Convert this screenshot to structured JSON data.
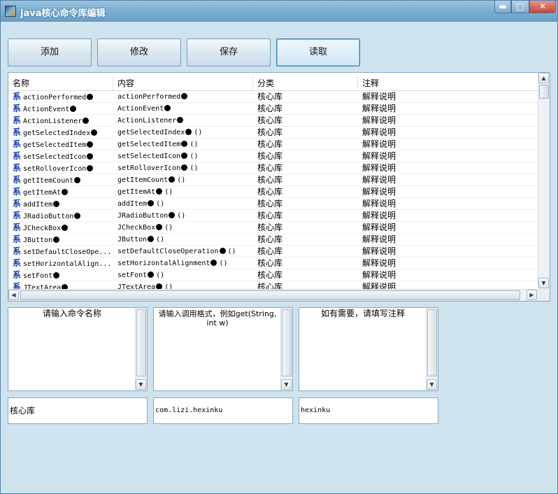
{
  "window": {
    "title": "java核心命令库编辑",
    "minimize_glyph": "▬",
    "maximize_glyph": "□",
    "close_glyph": "✕",
    "icon": "app-icon"
  },
  "toolbar": {
    "add_label": "添加",
    "edit_label": "修改",
    "save_label": "保存",
    "read_label": "读取"
  },
  "table": {
    "columns": [
      "名称",
      "内容",
      "分类",
      "注释"
    ],
    "row_icon_glyph": "系",
    "rows": [
      {
        "name": "actionPerformed",
        "content": "actionPerformed",
        "content_suffix": "",
        "category": "核心库",
        "note": "解释说明"
      },
      {
        "name": "ActionEvent",
        "content": "ActionEvent",
        "content_suffix": "",
        "category": "核心库",
        "note": "解释说明"
      },
      {
        "name": "ActionListener",
        "content": "ActionListener",
        "content_suffix": "",
        "category": "核心库",
        "note": "解释说明"
      },
      {
        "name": "getSelectedIndex",
        "content": "getSelectedIndex",
        "content_suffix": "()",
        "category": "核心库",
        "note": "解释说明"
      },
      {
        "name": "getSelectedItem",
        "content": "getSelectedItem",
        "content_suffix": "()",
        "category": "核心库",
        "note": "解释说明"
      },
      {
        "name": "setSelectedIcon",
        "content": "setSelectedIcon",
        "content_suffix": "()",
        "category": "核心库",
        "note": "解释说明"
      },
      {
        "name": "setRolloverIcon",
        "content": "setRolloverIcon",
        "content_suffix": "()",
        "category": "核心库",
        "note": "解释说明"
      },
      {
        "name": "getItemCount",
        "content": "getItemCount",
        "content_suffix": "()",
        "category": "核心库",
        "note": "解释说明"
      },
      {
        "name": "getItemAt",
        "content": "getItemAt",
        "content_suffix": "()",
        "category": "核心库",
        "note": "解释说明"
      },
      {
        "name": "addItem",
        "content": "addItem",
        "content_suffix": "()",
        "category": "核心库",
        "note": "解释说明"
      },
      {
        "name": "JRadioButton",
        "content": "JRadioButton",
        "content_suffix": "()",
        "category": "核心库",
        "note": "解释说明"
      },
      {
        "name": "JCheckBox",
        "content": "JCheckBox",
        "content_suffix": "()",
        "category": "核心库",
        "note": "解释说明"
      },
      {
        "name": "JButton",
        "content": "JButton",
        "content_suffix": "()",
        "category": "核心库",
        "note": "解释说明"
      },
      {
        "name": "setDefaultCloseOpe...",
        "content": "setDefaultCloseOperation",
        "content_suffix": "()",
        "category": "核心库",
        "note": "解释说明",
        "name_truncated": true
      },
      {
        "name": "setHorizontalAlign...",
        "content": "setHorizontalAlignment",
        "content_suffix": "()",
        "category": "核心库",
        "note": "解释说明",
        "name_truncated": true
      },
      {
        "name": "setFont",
        "content": "setFont",
        "content_suffix": "()",
        "category": "核心库",
        "note": "解释说明"
      },
      {
        "name": "JTextArea",
        "content": "JTextArea",
        "content_suffix": "()",
        "category": "核心库",
        "note": "解释说明"
      }
    ]
  },
  "inputs": {
    "name_area_text": "请输入命令名称",
    "content_area_text": "请输入调用格式，例如get(String, int w)",
    "note_area_text": "如有需要，请填写注释",
    "category_field": "核心库",
    "package_field": "com.lizi.hexinku",
    "library_field": "hexinku"
  },
  "colors": {
    "window_bg": "#cfe3ef",
    "row_icon": "#1a3fa8"
  }
}
